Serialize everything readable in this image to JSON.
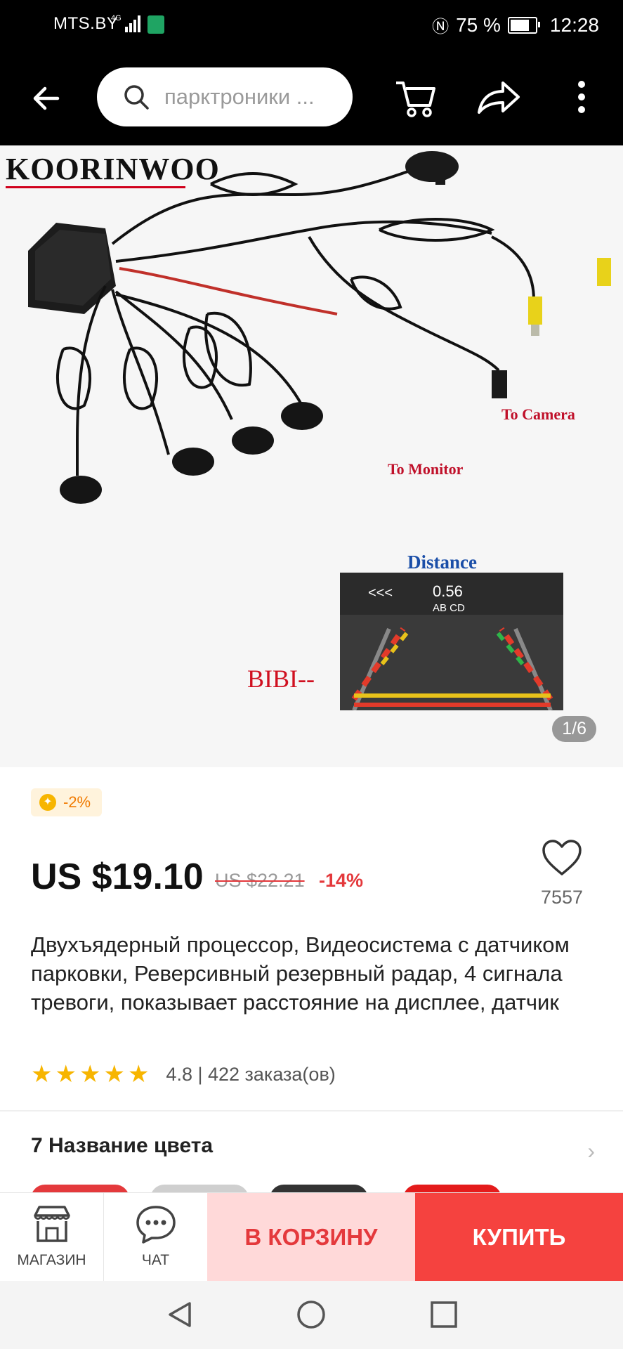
{
  "status_bar": {
    "carrier": "MTS.BY",
    "network": "4G",
    "battery": "75 %",
    "time": "12:28"
  },
  "toolbar": {
    "search_placeholder": "парктроники ..."
  },
  "gallery": {
    "brand_logo": "KOORINWOO",
    "label_camera": "To Camera",
    "label_monitor": "To Monitor",
    "label_distance": "Distance",
    "screen_arrows": "<<<",
    "screen_distance": "0.56",
    "screen_sensors": "AB  CD",
    "label_bibi": "BIBI--",
    "counter": "1/6"
  },
  "product": {
    "coupon": "-2%",
    "price": "US $19.10",
    "old_price": "US $22.21",
    "discount": "-14%",
    "wishlist_count": "7557",
    "title": "Двухъядерный процессор, Видеосистема с датчиком парковки, Реверсивный резервный радар, 4 сигнала тревоги, показывает расстояние на дисплее, датчик",
    "rating": 4.8,
    "rating_text": "4.8 | 422 заказа(ов)",
    "color_section": "7 Название цвета"
  },
  "action_bar": {
    "store_label": "МАГАЗИН",
    "chat_label": "ЧАТ",
    "add_to_cart": "В КОРЗИНУ",
    "buy_now": "КУПИТЬ"
  },
  "colors": {
    "accent": "#e4393c",
    "buy_button": "#f5423f",
    "cart_button_bg": "#ffd9d9",
    "star": "#f7b500"
  }
}
